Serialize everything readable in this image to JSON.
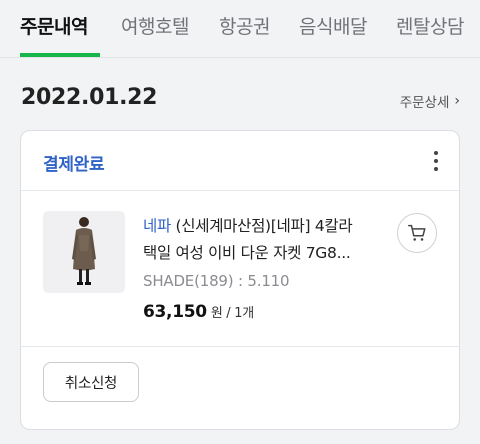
{
  "tabs": [
    {
      "label": "주문내역",
      "active": true
    },
    {
      "label": "여행호텔",
      "active": false
    },
    {
      "label": "항공권",
      "active": false
    },
    {
      "label": "음식배달",
      "active": false
    },
    {
      "label": "렌탈상담",
      "active": false
    }
  ],
  "order": {
    "date": "2022.01.22",
    "detail_link": "주문상세",
    "status": "결제완료",
    "product": {
      "brand": "네파",
      "name_line1_rest": " (신세계마산점)[네파] 4칼라",
      "name_line2": "택일 여성 이비 다운 자켓 7G8...",
      "option": "SHADE(189) : 5.110",
      "price": "63,150",
      "price_unit": "원 / 1개"
    },
    "cancel_button": "취소신청"
  },
  "colors": {
    "accent_green": "#17b54a",
    "status_blue": "#2f63c6"
  }
}
